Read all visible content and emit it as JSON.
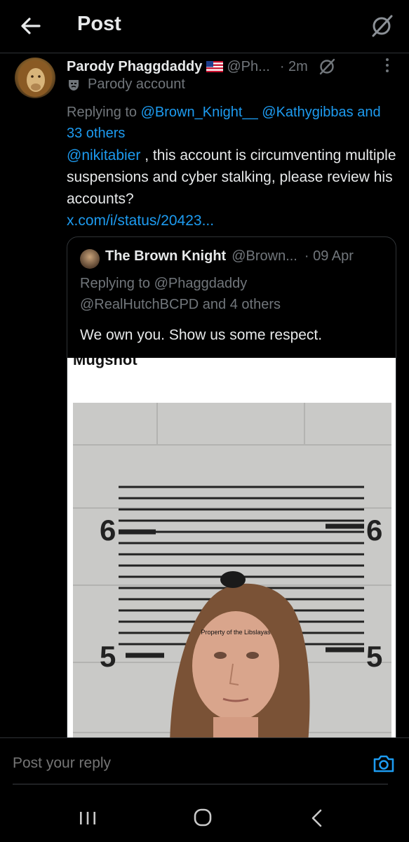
{
  "header": {
    "title": "Post"
  },
  "tweet": {
    "display_name": "Parody Phaggdaddy",
    "handle": "@Ph...",
    "time": "· 2m",
    "parody_label": "Parody account",
    "replying_prefix": "Replying to ",
    "replying_user1": "@Brown_Knight__",
    "replying_user2": "@Kathygibbas",
    "replying_others": "and 33 others",
    "mention": "@nikitabier",
    "text": " , this account is circumventing multiple suspensions and cyber stalking, please review his accounts?",
    "link": "x.com/i/status/20423..."
  },
  "quote": {
    "display_name": "The Brown Knight",
    "handle": "@Brown...",
    "time": "· 09 Apr",
    "replying_line1": "Replying to @Phaggdaddy",
    "replying_line2": "@RealHutchBCPD and 4 others",
    "text": "We own you. Show us some respect.",
    "image_label": "Mugshot",
    "height_mark_top": "6",
    "height_mark_bottom": "5",
    "forehead_text": "Property of the Libslayas"
  },
  "reply": {
    "placeholder": "Post your reply"
  },
  "colors": {
    "background": "#000000",
    "text_primary": "#e7e9ea",
    "text_secondary": "#71767b",
    "link": "#1d9bf0",
    "divider": "#2f3336"
  },
  "icons": {
    "back": "arrow-left-icon",
    "grok": "slash-circle-icon",
    "more": "vertical-dots-icon",
    "parody": "mask-icon",
    "camera": "camera-icon",
    "nav_recent": "recent-apps-icon",
    "nav_home": "home-circle-icon",
    "nav_back": "chevron-left-icon"
  }
}
